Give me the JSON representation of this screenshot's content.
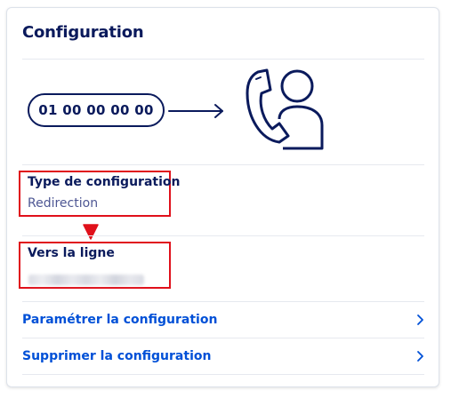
{
  "card": {
    "title": "Configuration"
  },
  "illustration": {
    "phone_number": "01 00 00 00 00",
    "arrow_icon": "arrow-right-icon",
    "contact_icon": "phone-contact-icon"
  },
  "fields": [
    {
      "label": "Type de configuration",
      "value": "Redirection"
    },
    {
      "label": "Vers la ligne",
      "value_blurred": true
    }
  ],
  "actions": [
    {
      "label": "Paramétrer la configuration",
      "icon": "chevron-right-icon"
    },
    {
      "label": "Supprimer la configuration",
      "icon": "chevron-right-icon"
    }
  ],
  "colors": {
    "title": "#0a1a5c",
    "link": "#0050d7",
    "value": "#4d5693",
    "annotation": "#e0101b",
    "divider": "#e6e9ef"
  }
}
